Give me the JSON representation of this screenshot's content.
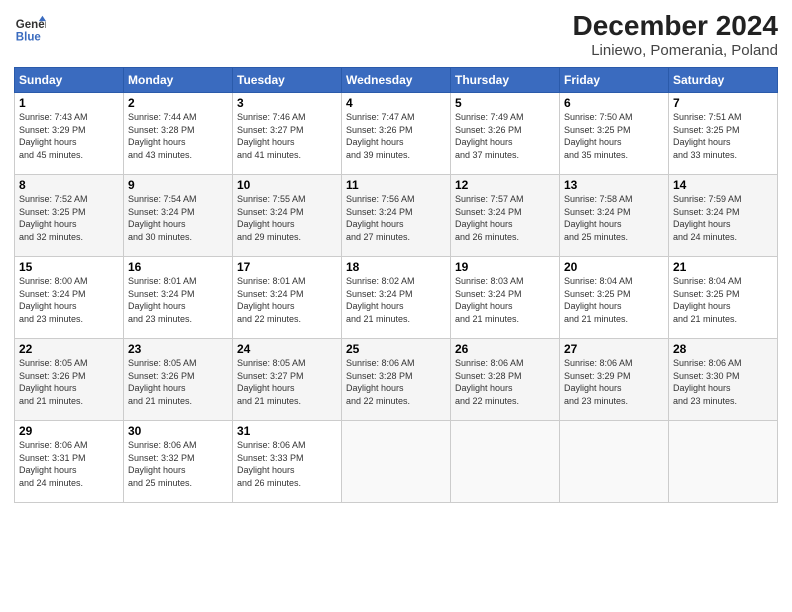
{
  "header": {
    "title": "December 2024",
    "subtitle": "Liniewo, Pomerania, Poland",
    "logo_line1": "General",
    "logo_line2": "Blue"
  },
  "days_of_week": [
    "Sunday",
    "Monday",
    "Tuesday",
    "Wednesday",
    "Thursday",
    "Friday",
    "Saturday"
  ],
  "weeks": [
    [
      {
        "day": 1,
        "sunrise": "7:43 AM",
        "sunset": "3:29 PM",
        "daylight": "7 hours and 45 minutes."
      },
      {
        "day": 2,
        "sunrise": "7:44 AM",
        "sunset": "3:28 PM",
        "daylight": "7 hours and 43 minutes."
      },
      {
        "day": 3,
        "sunrise": "7:46 AM",
        "sunset": "3:27 PM",
        "daylight": "7 hours and 41 minutes."
      },
      {
        "day": 4,
        "sunrise": "7:47 AM",
        "sunset": "3:26 PM",
        "daylight": "7 hours and 39 minutes."
      },
      {
        "day": 5,
        "sunrise": "7:49 AM",
        "sunset": "3:26 PM",
        "daylight": "7 hours and 37 minutes."
      },
      {
        "day": 6,
        "sunrise": "7:50 AM",
        "sunset": "3:25 PM",
        "daylight": "7 hours and 35 minutes."
      },
      {
        "day": 7,
        "sunrise": "7:51 AM",
        "sunset": "3:25 PM",
        "daylight": "7 hours and 33 minutes."
      }
    ],
    [
      {
        "day": 8,
        "sunrise": "7:52 AM",
        "sunset": "3:25 PM",
        "daylight": "7 hours and 32 minutes."
      },
      {
        "day": 9,
        "sunrise": "7:54 AM",
        "sunset": "3:24 PM",
        "daylight": "7 hours and 30 minutes."
      },
      {
        "day": 10,
        "sunrise": "7:55 AM",
        "sunset": "3:24 PM",
        "daylight": "7 hours and 29 minutes."
      },
      {
        "day": 11,
        "sunrise": "7:56 AM",
        "sunset": "3:24 PM",
        "daylight": "7 hours and 27 minutes."
      },
      {
        "day": 12,
        "sunrise": "7:57 AM",
        "sunset": "3:24 PM",
        "daylight": "7 hours and 26 minutes."
      },
      {
        "day": 13,
        "sunrise": "7:58 AM",
        "sunset": "3:24 PM",
        "daylight": "7 hours and 25 minutes."
      },
      {
        "day": 14,
        "sunrise": "7:59 AM",
        "sunset": "3:24 PM",
        "daylight": "7 hours and 24 minutes."
      }
    ],
    [
      {
        "day": 15,
        "sunrise": "8:00 AM",
        "sunset": "3:24 PM",
        "daylight": "7 hours and 23 minutes."
      },
      {
        "day": 16,
        "sunrise": "8:01 AM",
        "sunset": "3:24 PM",
        "daylight": "7 hours and 23 minutes."
      },
      {
        "day": 17,
        "sunrise": "8:01 AM",
        "sunset": "3:24 PM",
        "daylight": "7 hours and 22 minutes."
      },
      {
        "day": 18,
        "sunrise": "8:02 AM",
        "sunset": "3:24 PM",
        "daylight": "7 hours and 21 minutes."
      },
      {
        "day": 19,
        "sunrise": "8:03 AM",
        "sunset": "3:24 PM",
        "daylight": "7 hours and 21 minutes."
      },
      {
        "day": 20,
        "sunrise": "8:04 AM",
        "sunset": "3:25 PM",
        "daylight": "7 hours and 21 minutes."
      },
      {
        "day": 21,
        "sunrise": "8:04 AM",
        "sunset": "3:25 PM",
        "daylight": "7 hours and 21 minutes."
      }
    ],
    [
      {
        "day": 22,
        "sunrise": "8:05 AM",
        "sunset": "3:26 PM",
        "daylight": "7 hours and 21 minutes."
      },
      {
        "day": 23,
        "sunrise": "8:05 AM",
        "sunset": "3:26 PM",
        "daylight": "7 hours and 21 minutes."
      },
      {
        "day": 24,
        "sunrise": "8:05 AM",
        "sunset": "3:27 PM",
        "daylight": "7 hours and 21 minutes."
      },
      {
        "day": 25,
        "sunrise": "8:06 AM",
        "sunset": "3:28 PM",
        "daylight": "7 hours and 22 minutes."
      },
      {
        "day": 26,
        "sunrise": "8:06 AM",
        "sunset": "3:28 PM",
        "daylight": "7 hours and 22 minutes."
      },
      {
        "day": 27,
        "sunrise": "8:06 AM",
        "sunset": "3:29 PM",
        "daylight": "7 hours and 23 minutes."
      },
      {
        "day": 28,
        "sunrise": "8:06 AM",
        "sunset": "3:30 PM",
        "daylight": "7 hours and 23 minutes."
      }
    ],
    [
      {
        "day": 29,
        "sunrise": "8:06 AM",
        "sunset": "3:31 PM",
        "daylight": "7 hours and 24 minutes."
      },
      {
        "day": 30,
        "sunrise": "8:06 AM",
        "sunset": "3:32 PM",
        "daylight": "7 hours and 25 minutes."
      },
      {
        "day": 31,
        "sunrise": "8:06 AM",
        "sunset": "3:33 PM",
        "daylight": "7 hours and 26 minutes."
      },
      null,
      null,
      null,
      null
    ]
  ]
}
